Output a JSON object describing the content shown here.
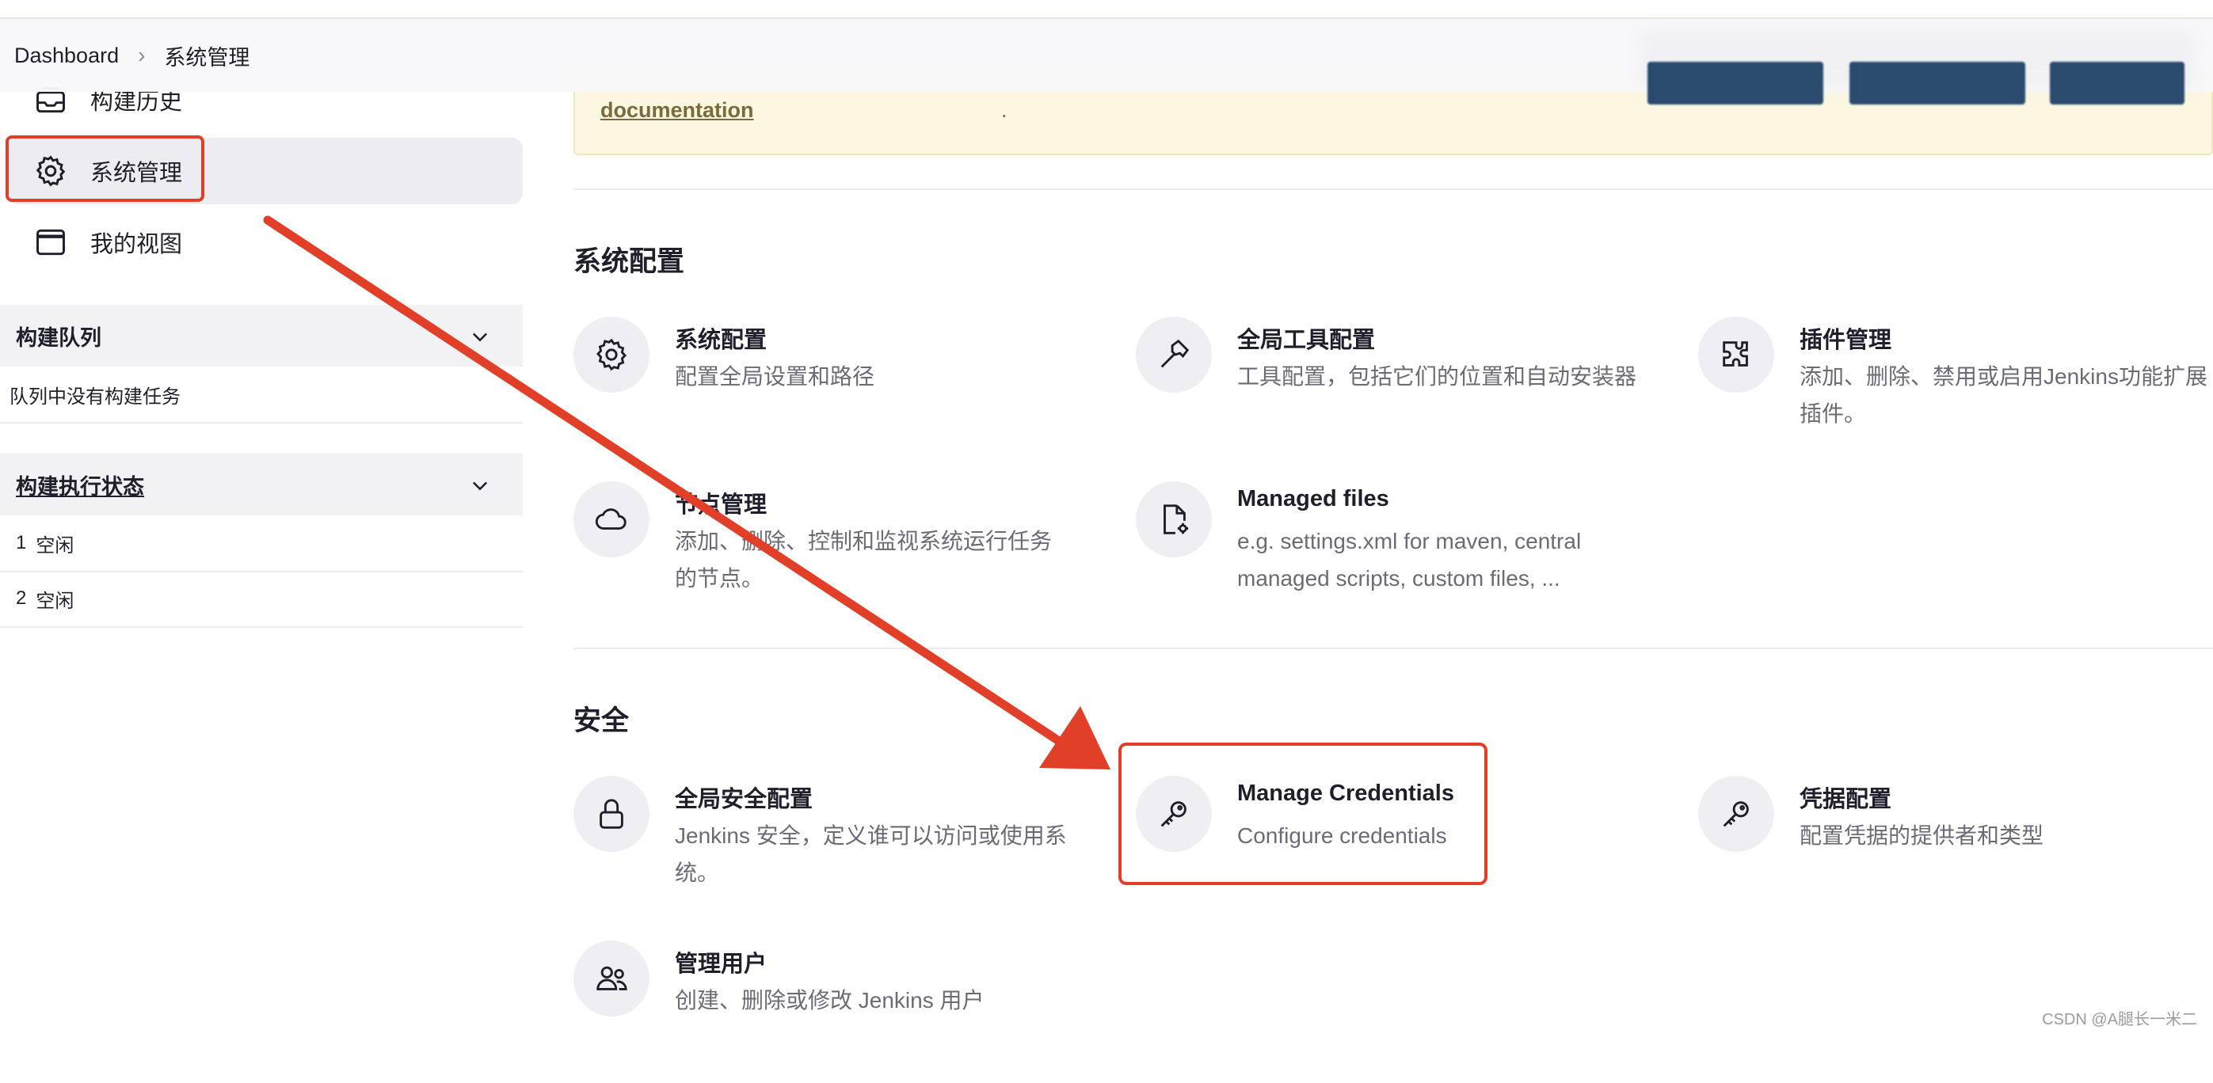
{
  "breadcrumb": {
    "home": "Dashboard",
    "separator": "›",
    "current": "系统管理"
  },
  "notice": {
    "link_text": "documentation",
    "suffix": "."
  },
  "sidebar": {
    "items": [
      {
        "label": "构建历史",
        "icon": "inbox-icon"
      },
      {
        "label": "系统管理",
        "icon": "gear-icon",
        "active": true
      },
      {
        "label": "我的视图",
        "icon": "window-icon"
      }
    ],
    "queue": {
      "title": "构建队列",
      "empty_text": "队列中没有构建任务"
    },
    "executors": {
      "title": "构建执行状态",
      "rows": [
        {
          "num": "1",
          "state": "空闲"
        },
        {
          "num": "2",
          "state": "空闲"
        }
      ]
    }
  },
  "sections": [
    {
      "title": "系统配置",
      "cards": [
        {
          "title": "系统配置",
          "desc": "配置全局设置和路径",
          "icon": "gear-icon"
        },
        {
          "title": "全局工具配置",
          "desc": "工具配置，包括它们的位置和自动安装器",
          "icon": "hammer-icon"
        },
        {
          "title": "插件管理",
          "desc": "添加、删除、禁用或启用Jenkins功能扩展插件。",
          "icon": "puzzle-icon"
        },
        {
          "title": "节点管理",
          "desc": "添加、删除、控制和监视系统运行任务的节点。",
          "icon": "cloud-icon"
        },
        {
          "title": "Managed files",
          "desc": "e.g. settings.xml for maven, central managed scripts, custom files, ...",
          "icon": "file-gear-icon"
        }
      ]
    },
    {
      "title": "安全",
      "cards": [
        {
          "title": "全局安全配置",
          "desc": "Jenkins 安全，定义谁可以访问或使用系统。",
          "icon": "lock-icon"
        },
        {
          "title": "Manage Credentials",
          "desc": "Configure credentials",
          "icon": "key-icon"
        },
        {
          "title": "凭据配置",
          "desc": "配置凭据的提供者和类型",
          "icon": "key-icon"
        },
        {
          "title": "管理用户",
          "desc": "创建、删除或修改 Jenkins 用户",
          "icon": "users-icon"
        }
      ]
    }
  ],
  "watermark": "CSDN @A腿长一米二",
  "colors": {
    "highlight": "#e23f28",
    "notice_bg": "#fbf7e1",
    "card_icon_bg": "#efeff3"
  }
}
